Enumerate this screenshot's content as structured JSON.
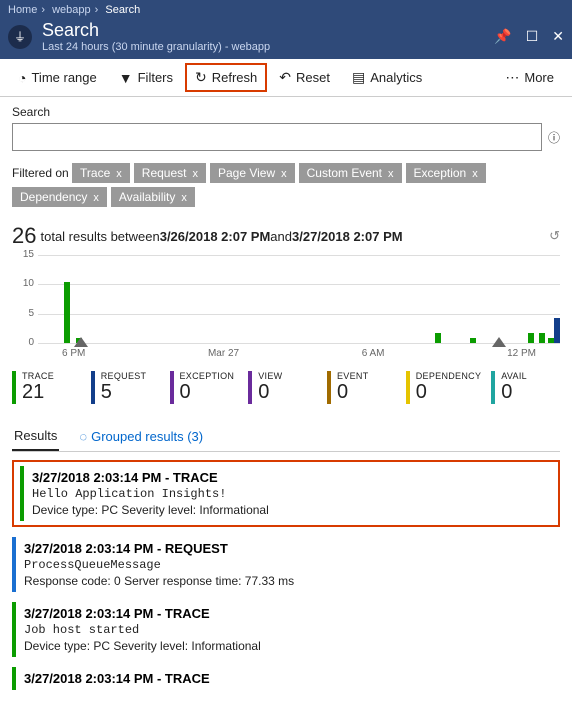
{
  "breadcrumb": {
    "home": "Home",
    "app": "webapp",
    "page": "Search"
  },
  "title": "Search",
  "subtitle": "Last 24 hours (30 minute granularity) - webapp",
  "toolbar": {
    "timerange": "Time range",
    "filters": "Filters",
    "refresh": "Refresh",
    "reset": "Reset",
    "analytics": "Analytics",
    "more": "More"
  },
  "search": {
    "label": "Search",
    "placeholder": ""
  },
  "filteredOn": "Filtered on",
  "chips": [
    "Trace",
    "Request",
    "Page View",
    "Custom Event",
    "Exception",
    "Dependency",
    "Availability"
  ],
  "summary": {
    "count": "26",
    "a": " total results between ",
    "start": "3/26/2018 2:07 PM",
    "mid": " and ",
    "end": "3/27/2018 2:07 PM"
  },
  "chart_data": {
    "type": "bar",
    "xLabels": [
      "6 PM",
      "Mar 27",
      "6 AM",
      "12 PM"
    ],
    "yTicks": [
      0,
      5,
      10,
      15
    ],
    "series": [
      {
        "kind": "trace",
        "color": "#0b9c00",
        "values": [
          0,
          0,
          12,
          1,
          0,
          0,
          0,
          0,
          0,
          0,
          0,
          0,
          0,
          0,
          0,
          0,
          0,
          0,
          0,
          0,
          0,
          0,
          0,
          0,
          0,
          0,
          0,
          0,
          0,
          0,
          0,
          0,
          0,
          0,
          2,
          0,
          0,
          1,
          0,
          0,
          0,
          0,
          2,
          2,
          1
        ]
      },
      {
        "kind": "request",
        "color": "#123e8a",
        "values": [
          0,
          0,
          0,
          0,
          0,
          0,
          0,
          0,
          0,
          0,
          0,
          0,
          0,
          0,
          0,
          0,
          0,
          0,
          0,
          0,
          0,
          0,
          0,
          0,
          0,
          0,
          0,
          0,
          0,
          0,
          0,
          0,
          0,
          0,
          0,
          0,
          0,
          0,
          0,
          0,
          0,
          0,
          0,
          0,
          5
        ]
      }
    ],
    "yMax": 15
  },
  "stats": [
    {
      "label": "TRACE",
      "value": "21",
      "color": "#0b9c00"
    },
    {
      "label": "REQUEST",
      "value": "5",
      "color": "#123e8a"
    },
    {
      "label": "EXCEPTION",
      "value": "0",
      "color": "#6a2b9c"
    },
    {
      "label": "VIEW",
      "value": "0",
      "color": "#6a2b9c"
    },
    {
      "label": "EVENT",
      "value": "0",
      "color": "#a06b00"
    },
    {
      "label": "DEPENDENCY",
      "value": "0",
      "color": "#e5c400"
    },
    {
      "label": "AVAIL",
      "value": "0",
      "color": "#20a5a0"
    }
  ],
  "tabs": {
    "results": "Results",
    "grouped": "Grouped results (3)"
  },
  "results": [
    {
      "kind": "trace",
      "hl": true,
      "title": "3/27/2018 2:03:14 PM - TRACE",
      "msg": "Hello Application Insights!",
      "meta": "Device type: PC Severity level: Informational"
    },
    {
      "kind": "request",
      "title": "3/27/2018 2:03:14 PM - REQUEST",
      "msg": "ProcessQueueMessage",
      "meta": "Response code: 0 Server response time: 77.33 ms"
    },
    {
      "kind": "trace",
      "title": "3/27/2018 2:03:14 PM - TRACE",
      "msg": "Job host started",
      "meta": "Device type: PC Severity level: Informational"
    },
    {
      "kind": "trace",
      "title": "3/27/2018 2:03:14 PM - TRACE",
      "msg": "",
      "meta": ""
    }
  ]
}
